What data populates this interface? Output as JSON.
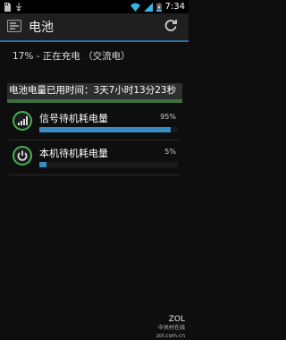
{
  "status_bar": {
    "time": "7:34",
    "icons": [
      "sd-card-icon",
      "usb-icon",
      "wifi-icon",
      "signal-icon",
      "battery-charging-icon"
    ]
  },
  "action_bar": {
    "title": "电池",
    "app_icon": "battery-settings-icon",
    "refresh_icon": "refresh-icon"
  },
  "battery": {
    "charging_text": "17% - 正在充电 （交流电）",
    "used_time_text": "电池电量已用时间：3天7小时13分23秒",
    "level": 0.17
  },
  "usage_items": [
    {
      "label": "信号待机耗电量",
      "percent_text": "95%",
      "percent": 95,
      "icon": "signal-bars-icon"
    },
    {
      "label": "本机待机耗电量",
      "percent_text": "5%",
      "percent": 5,
      "icon": "power-icon"
    }
  ],
  "watermark": {
    "main": "ZOL",
    "sub": "中关村在线",
    "url": "zol.com.cn"
  },
  "colors": {
    "accent": "#3a8cc4",
    "icon_green": "#43b14f"
  }
}
